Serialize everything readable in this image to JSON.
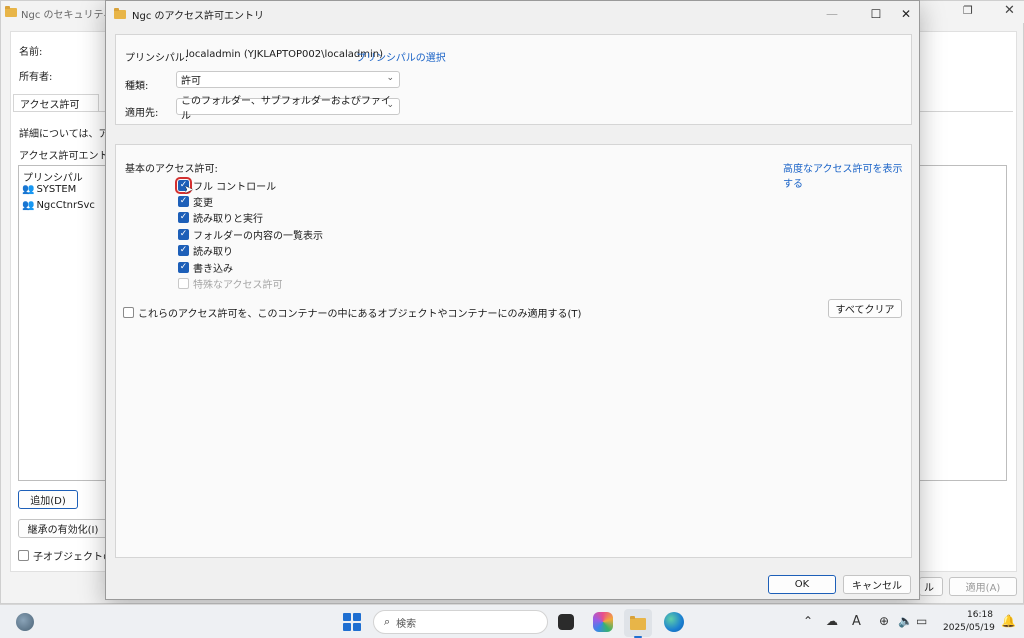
{
  "background_window": {
    "title": "Ngc のセキュリティの詳",
    "name_label": "名前:",
    "owner_label": "所有者:",
    "tab_permissions": "アクセス許可",
    "details_text": "詳細については、アク",
    "entries_label": "アクセス許可エントリ:",
    "list_header": "プリンシパル",
    "principals": [
      "SYSTEM",
      "NgcCtnrSvc"
    ],
    "add_button": "追加(D)",
    "inherit_button": "継承の有効化(I)",
    "child_objects_checkbox": "子オブジェクトのアク",
    "ok_partial": "ル",
    "apply_button": "適用(A)"
  },
  "dialog": {
    "title": "Ngc のアクセス許可エントリ",
    "principal_label": "プリンシパル:",
    "principal_value": "localadmin (YJKLAPTOP002\\localadmin)",
    "select_principal_link": "プリンシパルの選択",
    "type_label": "種類:",
    "type_value": "許可",
    "applies_to_label": "適用先:",
    "applies_to_value": "このフォルダー、サブフォルダーおよびファイル",
    "basic_permissions_label": "基本のアクセス許可:",
    "show_advanced_link": "高度なアクセス許可を表示する",
    "permissions": [
      {
        "label": "フル コントロール",
        "checked": true
      },
      {
        "label": "変更",
        "checked": true
      },
      {
        "label": "読み取りと実行",
        "checked": true
      },
      {
        "label": "フォルダーの内容の一覧表示",
        "checked": true
      },
      {
        "label": "読み取り",
        "checked": true
      },
      {
        "label": "書き込み",
        "checked": true
      },
      {
        "label": "特殊なアクセス許可",
        "checked": false
      }
    ],
    "apply_only_checkbox": "これらのアクセス許可を、このコンテナーの中にあるオブジェクトやコンテナーにのみ適用する(T)",
    "clear_all_button": "すべてクリア",
    "ok_button": "OK",
    "cancel_button": "キャンセル"
  },
  "taskbar": {
    "search_placeholder": "検索",
    "ime_indicator": "A",
    "time": "16:18",
    "date": "2025/05/19"
  },
  "colors": {
    "accent": "#1d5fb8",
    "link": "#1a63c7",
    "highlight_box": "#d32f2f"
  }
}
